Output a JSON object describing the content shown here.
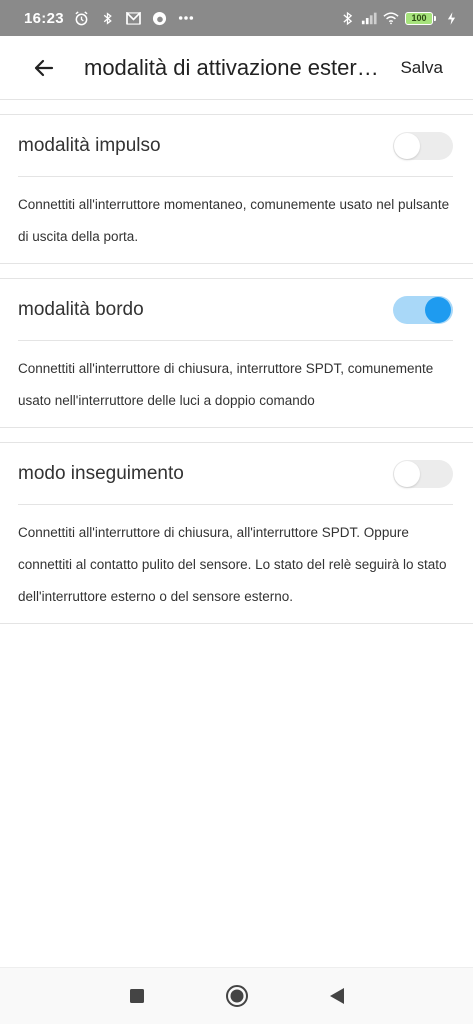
{
  "status_bar": {
    "time": "16:23",
    "battery": "100",
    "icons": [
      "alarm-icon",
      "bluetooth-app-icon",
      "m-app-icon",
      "vodafone-icon",
      "more-dots-icon",
      "bluetooth-icon",
      "signal-icon",
      "wifi-icon",
      "battery-icon",
      "charging-icon"
    ]
  },
  "app_bar": {
    "title": "modalità di attivazione esterna",
    "save_label": "Salva"
  },
  "sections": [
    {
      "label": "modalità impulso",
      "enabled": false,
      "description": "Connettiti all'interruttore momentaneo, comunemente usato nel pulsante di uscita della porta."
    },
    {
      "label": "modalità bordo",
      "enabled": true,
      "description": "Connettiti all'interruttore di chiusura, interruttore SPDT, comunemente usato nell'interruttore delle luci a doppio comando"
    },
    {
      "label": "modo inseguimento",
      "enabled": false,
      "description": "Connettiti all'interruttore di chiusura, all'interruttore SPDT. Oppure connettiti al contatto pulito del sensore. Lo stato del relè seguirà lo stato dell'interruttore esterno o del sensore esterno."
    }
  ],
  "colors": {
    "status_bar": "#8a8a8a",
    "toggle_on_track": "#a9d8f8",
    "toggle_on_knob": "#1e9bf0",
    "toggle_off_track": "#ececec"
  },
  "nav": [
    "recents-square-icon",
    "home-circle-icon",
    "back-triangle-icon"
  ]
}
